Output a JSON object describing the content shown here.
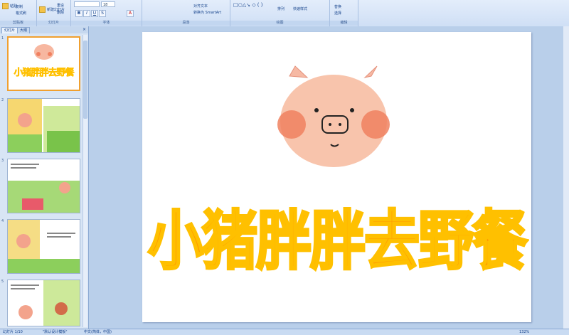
{
  "ribbon": {
    "groups": [
      {
        "label": "剪贴板",
        "items": [
          "粘贴",
          "复制",
          "格式刷"
        ]
      },
      {
        "label": "幻灯片",
        "items": [
          "新建幻灯片",
          "重设",
          "删除"
        ]
      },
      {
        "label": "字体",
        "items": [
          "B",
          "I",
          "U",
          "S",
          "A"
        ],
        "font_size": "18"
      },
      {
        "label": "段落",
        "items": [
          "对齐文本",
          "转换为 SmartArt"
        ]
      },
      {
        "label": "绘图",
        "items": [
          "排列",
          "快速样式"
        ]
      },
      {
        "label": "编辑",
        "items": [
          "替换",
          "选择"
        ]
      }
    ]
  },
  "panel": {
    "tabs": [
      "幻灯片",
      "大纲"
    ],
    "close": "×",
    "slides": [
      {
        "num": "1",
        "title": "小猪胖胖去野餐"
      },
      {
        "num": "2"
      },
      {
        "num": "3"
      },
      {
        "num": "4"
      },
      {
        "num": "5"
      }
    ]
  },
  "slide": {
    "title": "小猪胖胖去野餐"
  },
  "status": {
    "slide_info": "幻灯片 1/10",
    "theme": "\"默认设计模板\"",
    "language": "中文(简体，中国)",
    "zoom": "132%"
  },
  "colors": {
    "title_fill": "#ff9a00",
    "title_outline": "#ffc000",
    "ribbon_bg": "#dfe9f8",
    "canvas_bg": "#b9cfea"
  }
}
